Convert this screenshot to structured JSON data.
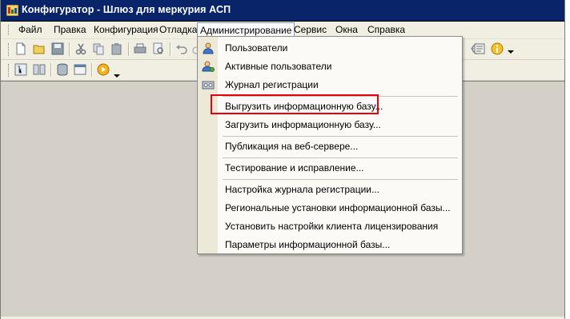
{
  "window": {
    "title": "Конфигуратор - Шлюз для меркурия АСП"
  },
  "menubar": {
    "items": [
      {
        "label": "Файл"
      },
      {
        "label": "Правка"
      },
      {
        "label": "Конфигурация"
      },
      {
        "label": "Отладка"
      },
      {
        "label": "Администрирование"
      },
      {
        "label": "Сервис"
      },
      {
        "label": "Окна"
      },
      {
        "label": "Справка"
      }
    ]
  },
  "dropdown": {
    "items": [
      {
        "label": "Пользователи",
        "icon": "user-icon"
      },
      {
        "label": "Активные пользователи",
        "icon": "active-users-icon"
      },
      {
        "label": "Журнал регистрации",
        "icon": "journal-icon"
      },
      {
        "label": "Выгрузить информационную базу..."
      },
      {
        "label": "Загрузить информационную базу..."
      },
      {
        "label": "Публикация на веб-сервере..."
      },
      {
        "label": "Тестирование и исправление..."
      },
      {
        "label": "Настройка журнала регистрации..."
      },
      {
        "label": "Региональные установки информационной базы..."
      },
      {
        "label": "Установить настройки клиента лицензирования"
      },
      {
        "label": "Параметры информационной базы..."
      }
    ]
  },
  "colors": {
    "titlebar": "#0a246a",
    "highlight_box": "#e8000c",
    "workspace": "#d4d0c8",
    "menu_bg": "#f1efe2"
  }
}
